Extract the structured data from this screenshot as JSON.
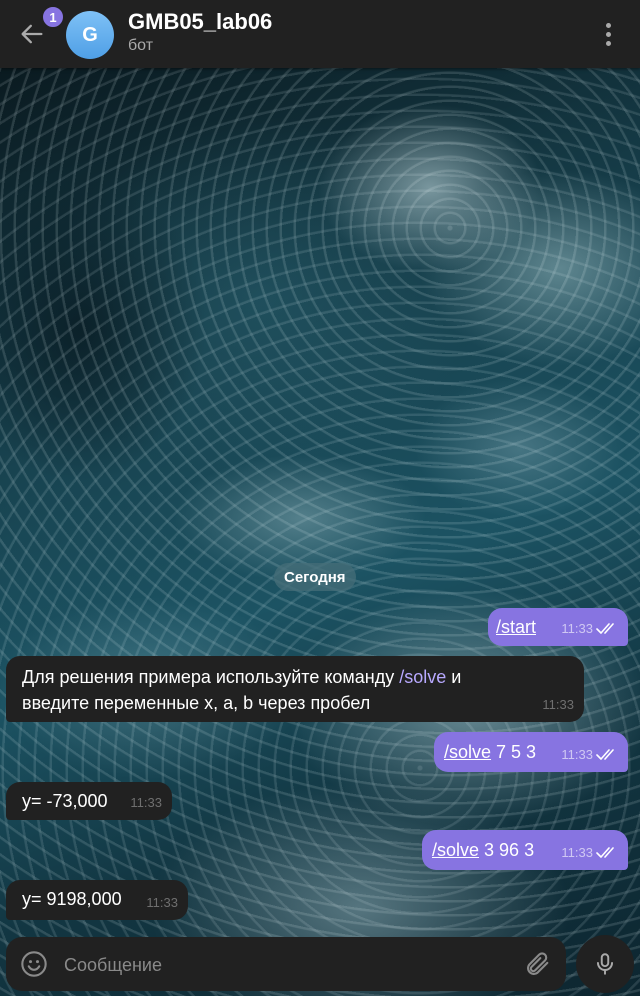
{
  "header": {
    "back_icon": "arrow-left-icon",
    "unread_count": "1",
    "avatar_letter": "G",
    "title": "GMB05_lab06",
    "subtitle": "бот",
    "menu_icon": "more-vertical-icon"
  },
  "chat": {
    "date_label": "Сегодня",
    "messages": [
      {
        "direction": "out",
        "command": "/start",
        "text": "",
        "time": "11:33",
        "read": true
      },
      {
        "direction": "in",
        "text_before": "Для решения примера используйте команду ",
        "command": "/solve",
        "text_after": " и",
        "line2": "введите переменные x, a, b через пробел",
        "time": "11:33"
      },
      {
        "direction": "out",
        "command": "/solve",
        "text": " 7 5 3",
        "time": "11:33",
        "read": true
      },
      {
        "direction": "in",
        "text": "y= -73,000",
        "time": "11:33"
      },
      {
        "direction": "out",
        "command": "/solve",
        "text": " 3 96 3",
        "time": "11:33",
        "read": true
      },
      {
        "direction": "in",
        "text": "y= 9198,000",
        "time": "11:33"
      }
    ]
  },
  "composer": {
    "placeholder": "Сообщение",
    "emoji_icon": "smile-icon",
    "attach_icon": "paperclip-icon",
    "mic_icon": "microphone-icon"
  },
  "colors": {
    "accent": "#8774e1",
    "header_bg": "#212121",
    "incoming_bubble": "#212121",
    "outgoing_bubble": "#8774e1"
  }
}
